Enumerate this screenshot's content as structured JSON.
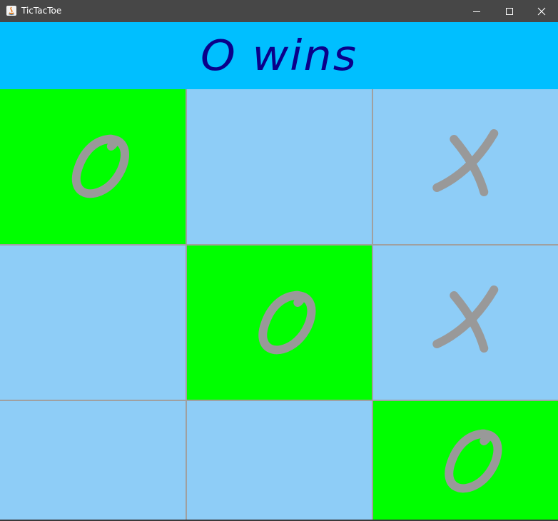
{
  "window": {
    "title": "TicTacToe",
    "app_icon": "java-icon",
    "controls": [
      "minimize-icon",
      "maximize-icon",
      "close-icon"
    ]
  },
  "status": {
    "text": "O wins"
  },
  "colors": {
    "banner_bg": "#00bfff",
    "status_text": "#0a008a",
    "cell_bg": "#8ecdf7",
    "win_cell_bg": "#00ff00",
    "mark": "#999999",
    "grid": "#a0a0a0"
  },
  "board": {
    "cells": [
      [
        "O",
        "",
        "X"
      ],
      [
        "",
        "O",
        "X"
      ],
      [
        "",
        "",
        "O"
      ]
    ],
    "winning_cells": [
      [
        0,
        0
      ],
      [
        1,
        1
      ],
      [
        2,
        2
      ]
    ]
  }
}
